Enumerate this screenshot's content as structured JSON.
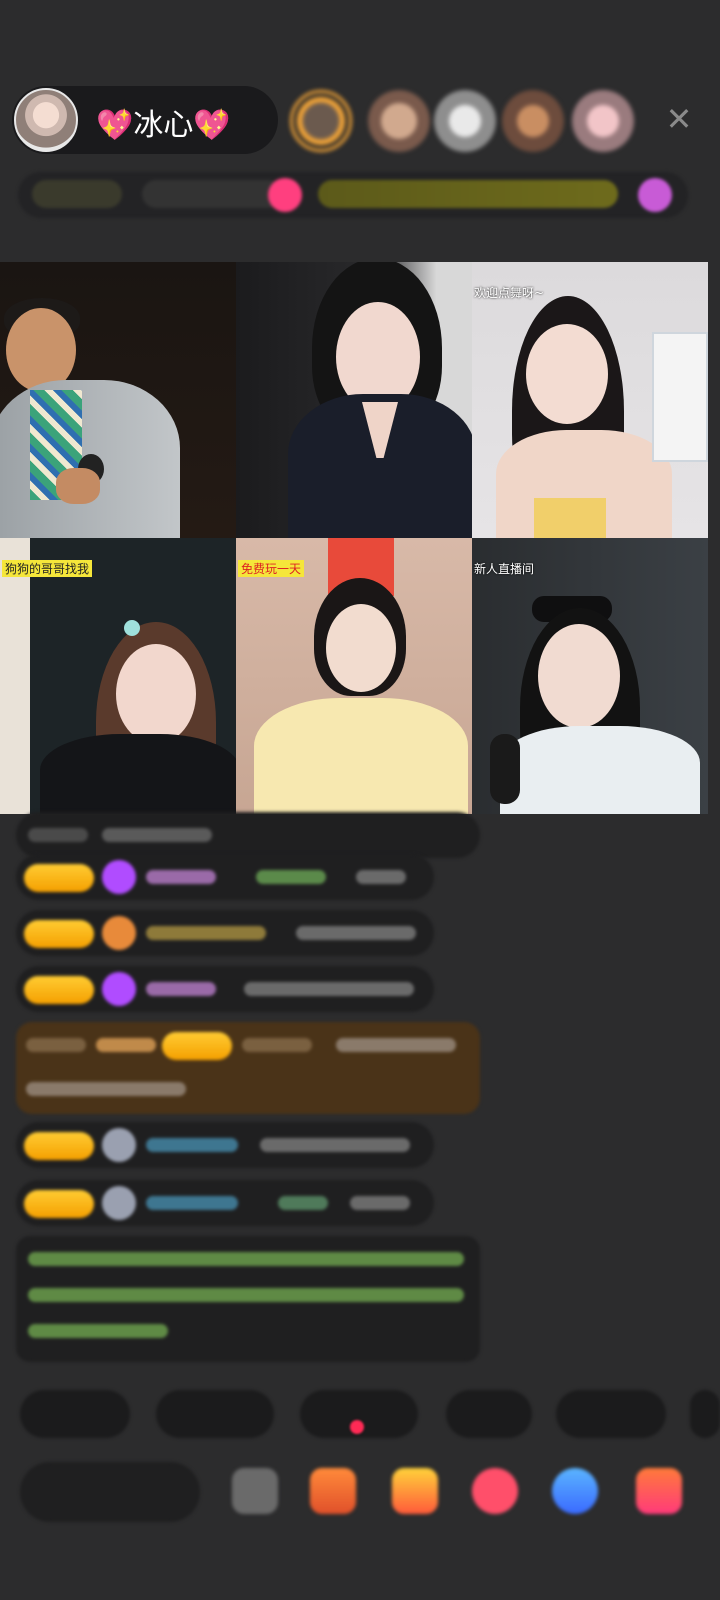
{
  "host": {
    "name": "💖冰心💖"
  },
  "grid": {
    "cells": [
      {
        "caption": ""
      },
      {
        "caption": ""
      },
      {
        "caption": "欢迎点舞呀~"
      },
      {
        "caption": "狗狗的哥哥找我"
      },
      {
        "caption": "免费玩一天"
      },
      {
        "caption": "新人直播间"
      }
    ]
  },
  "colors": {
    "background": "#2c2c2d",
    "badge_gold": "#f5a000",
    "chat_green": "#8bd35a",
    "chat_blue": "#5aa7d6",
    "chat_purple": "#b04cff",
    "highlight_bg": "#5a3c14"
  },
  "icons": {
    "close": "close-icon"
  }
}
